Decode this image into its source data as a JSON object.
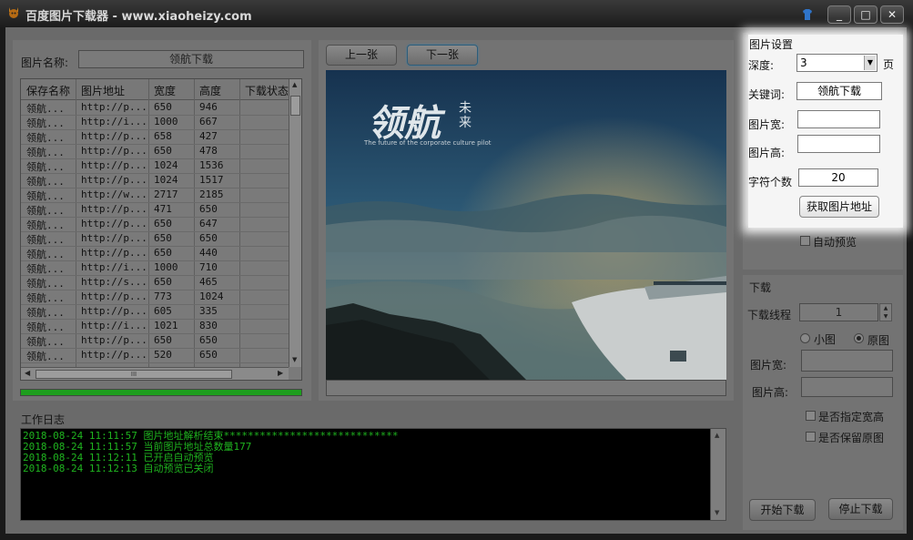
{
  "window": {
    "title": "百度图片下载器 - www.xiaoheizy.com",
    "controls": {
      "minimize": "_",
      "maximize": "□",
      "close": "✕"
    }
  },
  "left": {
    "name_label": "图片名称:",
    "name_value": "领航下载",
    "table": {
      "headers": [
        "保存名称",
        "图片地址",
        "宽度",
        "高度",
        "下载状态"
      ],
      "rows": [
        [
          "领航...",
          "http://p...",
          "650",
          "946",
          ""
        ],
        [
          "领航...",
          "http://i...",
          "1000",
          "667",
          ""
        ],
        [
          "领航...",
          "http://p...",
          "658",
          "427",
          ""
        ],
        [
          "领航...",
          "http://p...",
          "650",
          "478",
          ""
        ],
        [
          "领航...",
          "http://p...",
          "1024",
          "1536",
          ""
        ],
        [
          "领航...",
          "http://p...",
          "1024",
          "1517",
          ""
        ],
        [
          "领航...",
          "http://w...",
          "2717",
          "2185",
          ""
        ],
        [
          "领航...",
          "http://p...",
          "471",
          "650",
          ""
        ],
        [
          "领航...",
          "http://p...",
          "650",
          "647",
          ""
        ],
        [
          "领航...",
          "http://p...",
          "650",
          "650",
          ""
        ],
        [
          "领航...",
          "http://p...",
          "650",
          "440",
          ""
        ],
        [
          "领航...",
          "http://i...",
          "1000",
          "710",
          ""
        ],
        [
          "领航...",
          "http://s...",
          "650",
          "465",
          ""
        ],
        [
          "领航...",
          "http://p...",
          "773",
          "1024",
          ""
        ],
        [
          "领航...",
          "http://p...",
          "605",
          "335",
          ""
        ],
        [
          "领航...",
          "http://i...",
          "1021",
          "830",
          ""
        ],
        [
          "领航...",
          "http://p...",
          "650",
          "650",
          ""
        ],
        [
          "领航...",
          "http://p...",
          "520",
          "650",
          ""
        ]
      ]
    },
    "progress": 1.0
  },
  "preview": {
    "prev_label": "上一张",
    "next_label": "下一张",
    "image_logo": "领航",
    "image_logo_small": "未来",
    "image_tagline": "The future of the corporate culture pilot"
  },
  "log": {
    "title": "工作日志",
    "lines": [
      "2018-08-24 11:11:57 图片地址解析结束*****************************",
      "2018-08-24 11:11:57 当前图片地址总数量177",
      "2018-08-24 11:12:11 已开启自动预览",
      "2018-08-24 11:12:13 自动预览已关闭"
    ]
  },
  "settings": {
    "title": "图片设置",
    "depth_label": "深度:",
    "depth_value": "3",
    "depth_unit": "页",
    "keyword_label": "关键词:",
    "keyword_value": "领航下载",
    "width_label": "图片宽:",
    "width_value": "",
    "height_label": "图片高:",
    "height_value": "",
    "chars_label": "字符个数",
    "chars_value": "20",
    "fetch_button": "获取图片地址",
    "auto_preview_label": "自动预览"
  },
  "download": {
    "title": "下载",
    "threads_label": "下载线程",
    "threads_value": "1",
    "radio_small": "小图",
    "radio_original": "原图",
    "width_label": "图片宽:",
    "height_label": "图片高:",
    "chk_specify": "是否指定宽高",
    "chk_keep": "是否保留原图",
    "start_button": "开始下载",
    "stop_button": "停止下载"
  }
}
